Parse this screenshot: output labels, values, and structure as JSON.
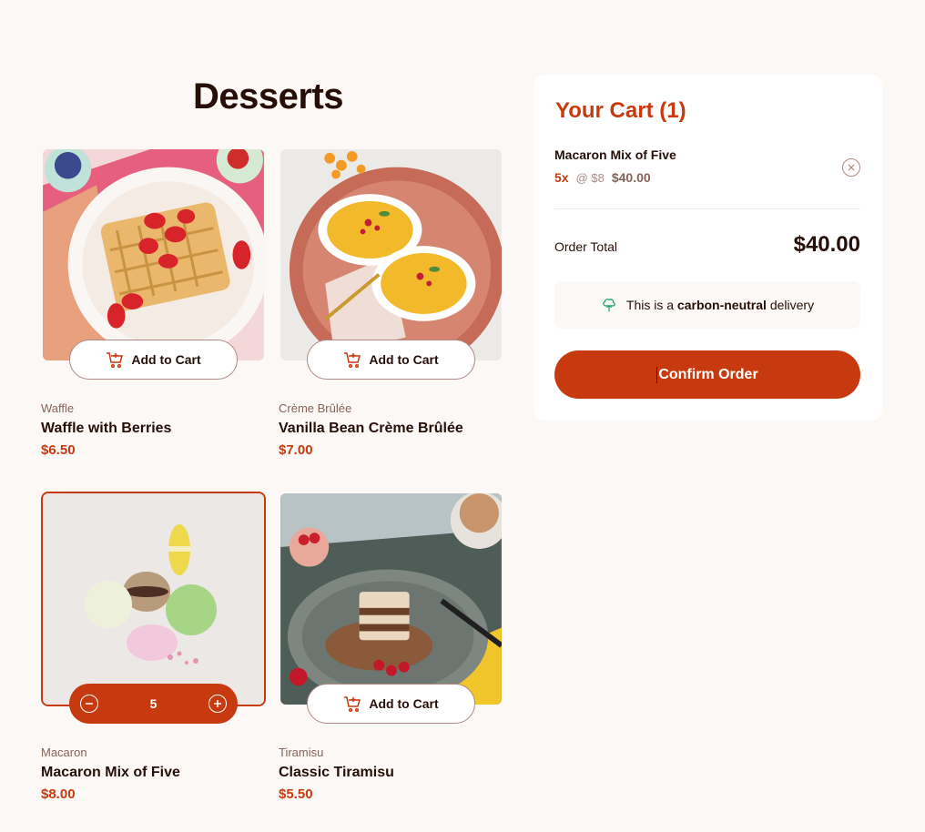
{
  "page": {
    "title": "Desserts"
  },
  "products": [
    {
      "category": "Waffle",
      "name": "Waffle with Berries",
      "price": "$6.50",
      "button": "Add to Cart",
      "in_cart": false
    },
    {
      "category": "Crème Brûlée",
      "name": "Vanilla Bean Crème Brûlée",
      "price": "$7.00",
      "button": "Add to Cart",
      "in_cart": false
    },
    {
      "category": "Macaron",
      "name": "Macaron Mix of Five",
      "price": "$8.00",
      "quantity": "5",
      "in_cart": true
    },
    {
      "category": "Tiramisu",
      "name": "Classic Tiramisu",
      "price": "$5.50",
      "button": "Add to Cart",
      "in_cart": false
    }
  ],
  "cart": {
    "title": "Your Cart (1)",
    "items": [
      {
        "name": "Macaron Mix of Five",
        "qty": "5x",
        "unit": "@ $8",
        "total": "$40.00"
      }
    ],
    "order_total_label": "Order Total",
    "order_total": "$40.00",
    "carbon_prefix": "This is a",
    "carbon_bold": "carbon-neutral",
    "carbon_suffix": "delivery",
    "confirm_label": "Confirm Order"
  },
  "icons": {
    "add_to_cart": "cart-plus-icon",
    "decrement": "minus-circle-icon",
    "increment": "plus-circle-icon",
    "remove": "remove-x-icon",
    "carbon": "tree-icon"
  },
  "colors": {
    "accent": "#c73a0f",
    "text": "#260f08",
    "muted": "#87635a",
    "background": "#fcf8f6"
  }
}
